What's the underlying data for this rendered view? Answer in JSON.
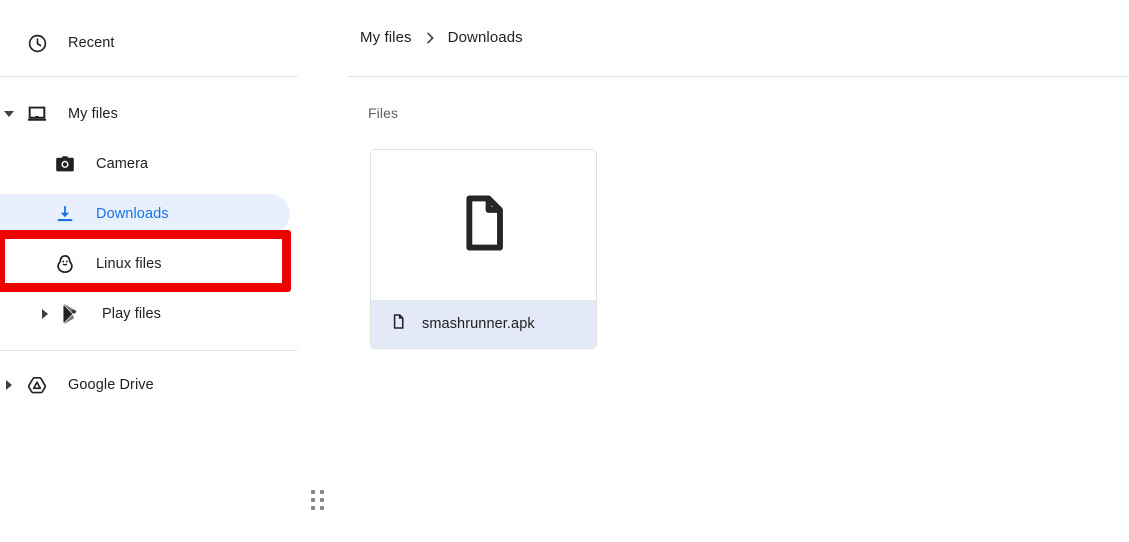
{
  "sidebar": {
    "items": [
      {
        "label": "Recent",
        "icon": "clock-icon",
        "twisty": "none",
        "indent": 0,
        "selected": false,
        "highlighted": false
      },
      {
        "label": "My files",
        "icon": "laptop-icon",
        "twisty": "expanded",
        "indent": 0,
        "selected": false,
        "highlighted": false
      },
      {
        "label": "Camera",
        "icon": "camera-icon",
        "twisty": "none",
        "indent": 1,
        "selected": false,
        "highlighted": false
      },
      {
        "label": "Downloads",
        "icon": "download-icon",
        "twisty": "none",
        "indent": 1,
        "selected": true,
        "highlighted": false
      },
      {
        "label": "Linux files",
        "icon": "penguin-icon",
        "twisty": "none",
        "indent": 1,
        "selected": false,
        "highlighted": true
      },
      {
        "label": "Play files",
        "icon": "google-play-icon",
        "twisty": "collapsed",
        "indent": 1,
        "selected": false,
        "highlighted": false
      },
      {
        "label": "Google Drive",
        "icon": "google-drive-icon",
        "twisty": "collapsed",
        "indent": 0,
        "selected": false,
        "highlighted": false
      }
    ]
  },
  "breadcrumb": {
    "root": "My files",
    "separator": "chevron-right-icon",
    "current": "Downloads"
  },
  "main": {
    "section_label": "Files",
    "files": [
      {
        "name": "smashrunner.apk",
        "icon": "generic-file-icon",
        "selected": true
      }
    ]
  },
  "annotation": {
    "color": "#ee0000",
    "target": "Linux files"
  },
  "colors": {
    "accent_blue": "#1a73e8",
    "selected_pill_bg": "#e8f0fe",
    "selected_card_bg": "#e3e9f7",
    "text_primary": "#202124",
    "text_secondary": "#5f6368",
    "divider": "#e0e0e0",
    "annotation_red": "#ee0000"
  }
}
